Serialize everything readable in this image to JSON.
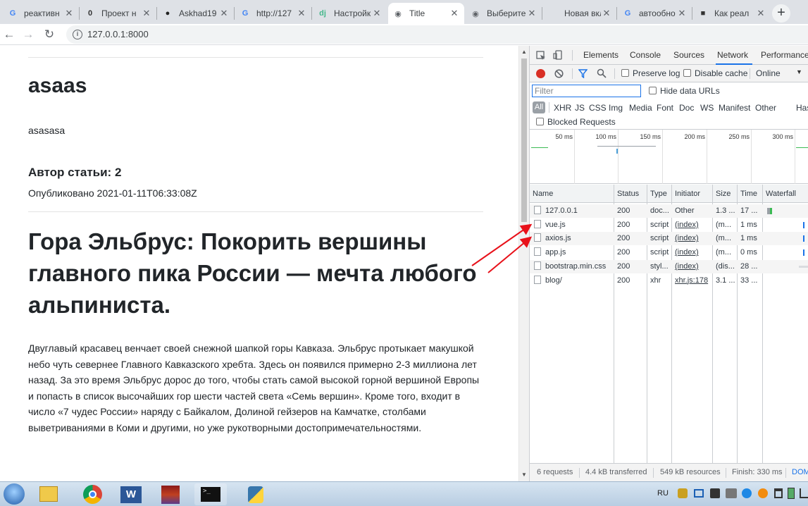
{
  "browser": {
    "tabs": [
      {
        "title": "реактивн",
        "fav": "G",
        "color": "#4285f4"
      },
      {
        "title": "Проект н",
        "fav": "0",
        "color": "#333"
      },
      {
        "title": "Askhad19",
        "fav": "●",
        "color": "#222"
      },
      {
        "title": "http://127",
        "fav": "G",
        "color": "#4285f4"
      },
      {
        "title": "Настройк",
        "fav": "dj",
        "color": "#44b78b"
      },
      {
        "title": "Title",
        "fav": "◉",
        "color": "#5f6368"
      },
      {
        "title": "Выберите",
        "fav": "◉",
        "color": "#5f6368"
      },
      {
        "title": "Новая вкладк",
        "fav": "",
        "color": "#5f6368"
      },
      {
        "title": "автообно",
        "fav": "G",
        "color": "#4285f4"
      },
      {
        "title": "Как реал",
        "fav": "■",
        "color": "#333"
      }
    ],
    "new_tab": "+",
    "url": "127.0.0.1:8000"
  },
  "article": {
    "title": "asaas",
    "subtitle": "asasasa",
    "author": "Автор статьи: 2",
    "published": "Опубликовано 2021-01-11T06:33:08Z",
    "heading": "Гора Эльбрус: Покорить вершины главного пика России — мечта любого альпиниста.",
    "body": "Двуглавый красавец венчает своей снежной шапкой горы Кавказа. Эльбрус протыкает макушкой небо чуть севернее Главного Кавказского хребта. Здесь он появился примерно 2-3 миллиона лет назад. За это время Эльбрус дорос до того, чтобы стать самой высокой горной вершиной Европы и попасть в список высочайших гор шести частей света «Семь вершин». Кроме того, входит в число «7 чудес России» наряду с Байкалом, Долиной гейзеров на Камчатке, столбами выветриваниями в Коми и другими, но уже рукотворными достопримечательностями."
  },
  "devtools": {
    "tabs": [
      "Elements",
      "Console",
      "Sources",
      "Network",
      "Performance"
    ],
    "active_tab": "Network",
    "preserve_log": "Preserve log",
    "disable_cache": "Disable cache",
    "throttle": "Online",
    "filter_placeholder": "Filter",
    "hide_data_urls": "Hide data URLs",
    "type_filters": [
      "All",
      "XHR",
      "JS",
      "CSS",
      "Img",
      "Media",
      "Font",
      "Doc",
      "WS",
      "Manifest",
      "Other",
      "Has"
    ],
    "blocked_requests": "Blocked Requests",
    "ticks": [
      "50 ms",
      "100 ms",
      "150 ms",
      "200 ms",
      "250 ms",
      "300 ms"
    ],
    "columns": [
      "Name",
      "Status",
      "Type",
      "Initiator",
      "Size",
      "Time",
      "Waterfall"
    ],
    "rows": [
      {
        "name": "127.0.0.1",
        "status": "200",
        "type": "doc...",
        "initiator": "Other",
        "size": "1.3 ...",
        "time": "17 ..."
      },
      {
        "name": "vue.js",
        "status": "200",
        "type": "script",
        "initiator": "(index)",
        "size": "(m...",
        "time": "1 ms"
      },
      {
        "name": "axios.js",
        "status": "200",
        "type": "script",
        "initiator": "(index)",
        "size": "(m...",
        "time": "1 ms"
      },
      {
        "name": "app.js",
        "status": "200",
        "type": "script",
        "initiator": "(index)",
        "size": "(m...",
        "time": "0 ms"
      },
      {
        "name": "bootstrap.min.css",
        "status": "200",
        "type": "styl...",
        "initiator": "(index)",
        "size": "(dis...",
        "time": "28 ..."
      },
      {
        "name": "blog/",
        "status": "200",
        "type": "xhr",
        "initiator": "xhr.js:178",
        "size": "3.1 ...",
        "time": "33 ..."
      }
    ],
    "summary": {
      "requests": "6 requests",
      "transferred": "4.4 kB transferred",
      "resources": "549 kB resources",
      "finish": "Finish: 330 ms",
      "dom": "DOM"
    }
  },
  "taskbar": {
    "lang": "RU"
  },
  "colors": {
    "accent": "#1a73e8",
    "record": "#d93025",
    "annotation_arrow": "#e8111a"
  }
}
